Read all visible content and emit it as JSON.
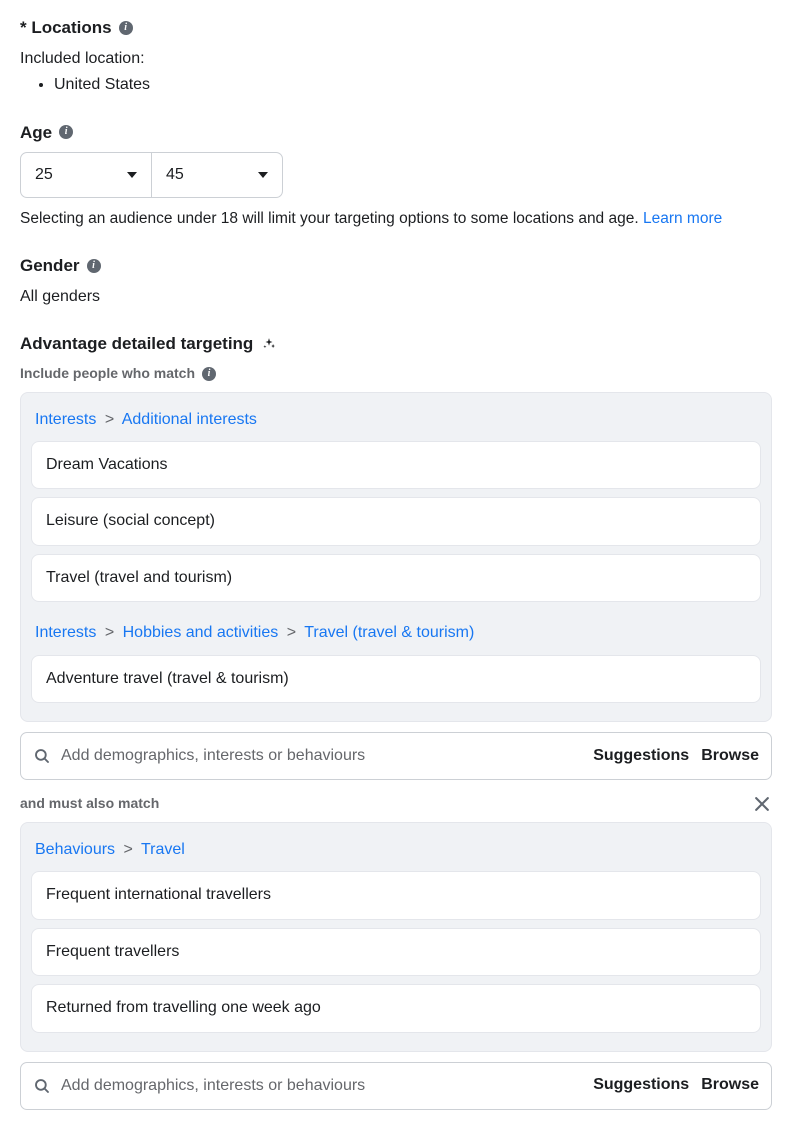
{
  "locations": {
    "label": "* Locations",
    "included_label": "Included location:",
    "items": [
      "United States"
    ]
  },
  "age": {
    "label": "Age",
    "min": "25",
    "max": "45",
    "helper_prefix": "Selecting an audience under 18 will limit your targeting options to some locations and age. ",
    "learn_more": "Learn more"
  },
  "gender": {
    "label": "Gender",
    "value": "All genders"
  },
  "detailed": {
    "label": "Advantage detailed targeting",
    "include_label": "Include people who match",
    "groups": [
      {
        "crumbs": [
          "Interests",
          "Additional interests"
        ],
        "items": [
          "Dream Vacations",
          "Leisure (social concept)",
          "Travel (travel and tourism)"
        ]
      },
      {
        "crumbs": [
          "Interests",
          "Hobbies and activities",
          "Travel (travel & tourism)"
        ],
        "items": [
          "Adventure travel (travel & tourism)"
        ]
      }
    ],
    "search_placeholder": "Add demographics, interests or behaviours",
    "suggestions_label": "Suggestions",
    "browse_label": "Browse",
    "also_match_label": "and must also match",
    "also_groups": [
      {
        "crumbs": [
          "Behaviours",
          "Travel"
        ],
        "items": [
          "Frequent international travellers",
          "Frequent travellers",
          "Returned from travelling one week ago"
        ]
      }
    ]
  }
}
